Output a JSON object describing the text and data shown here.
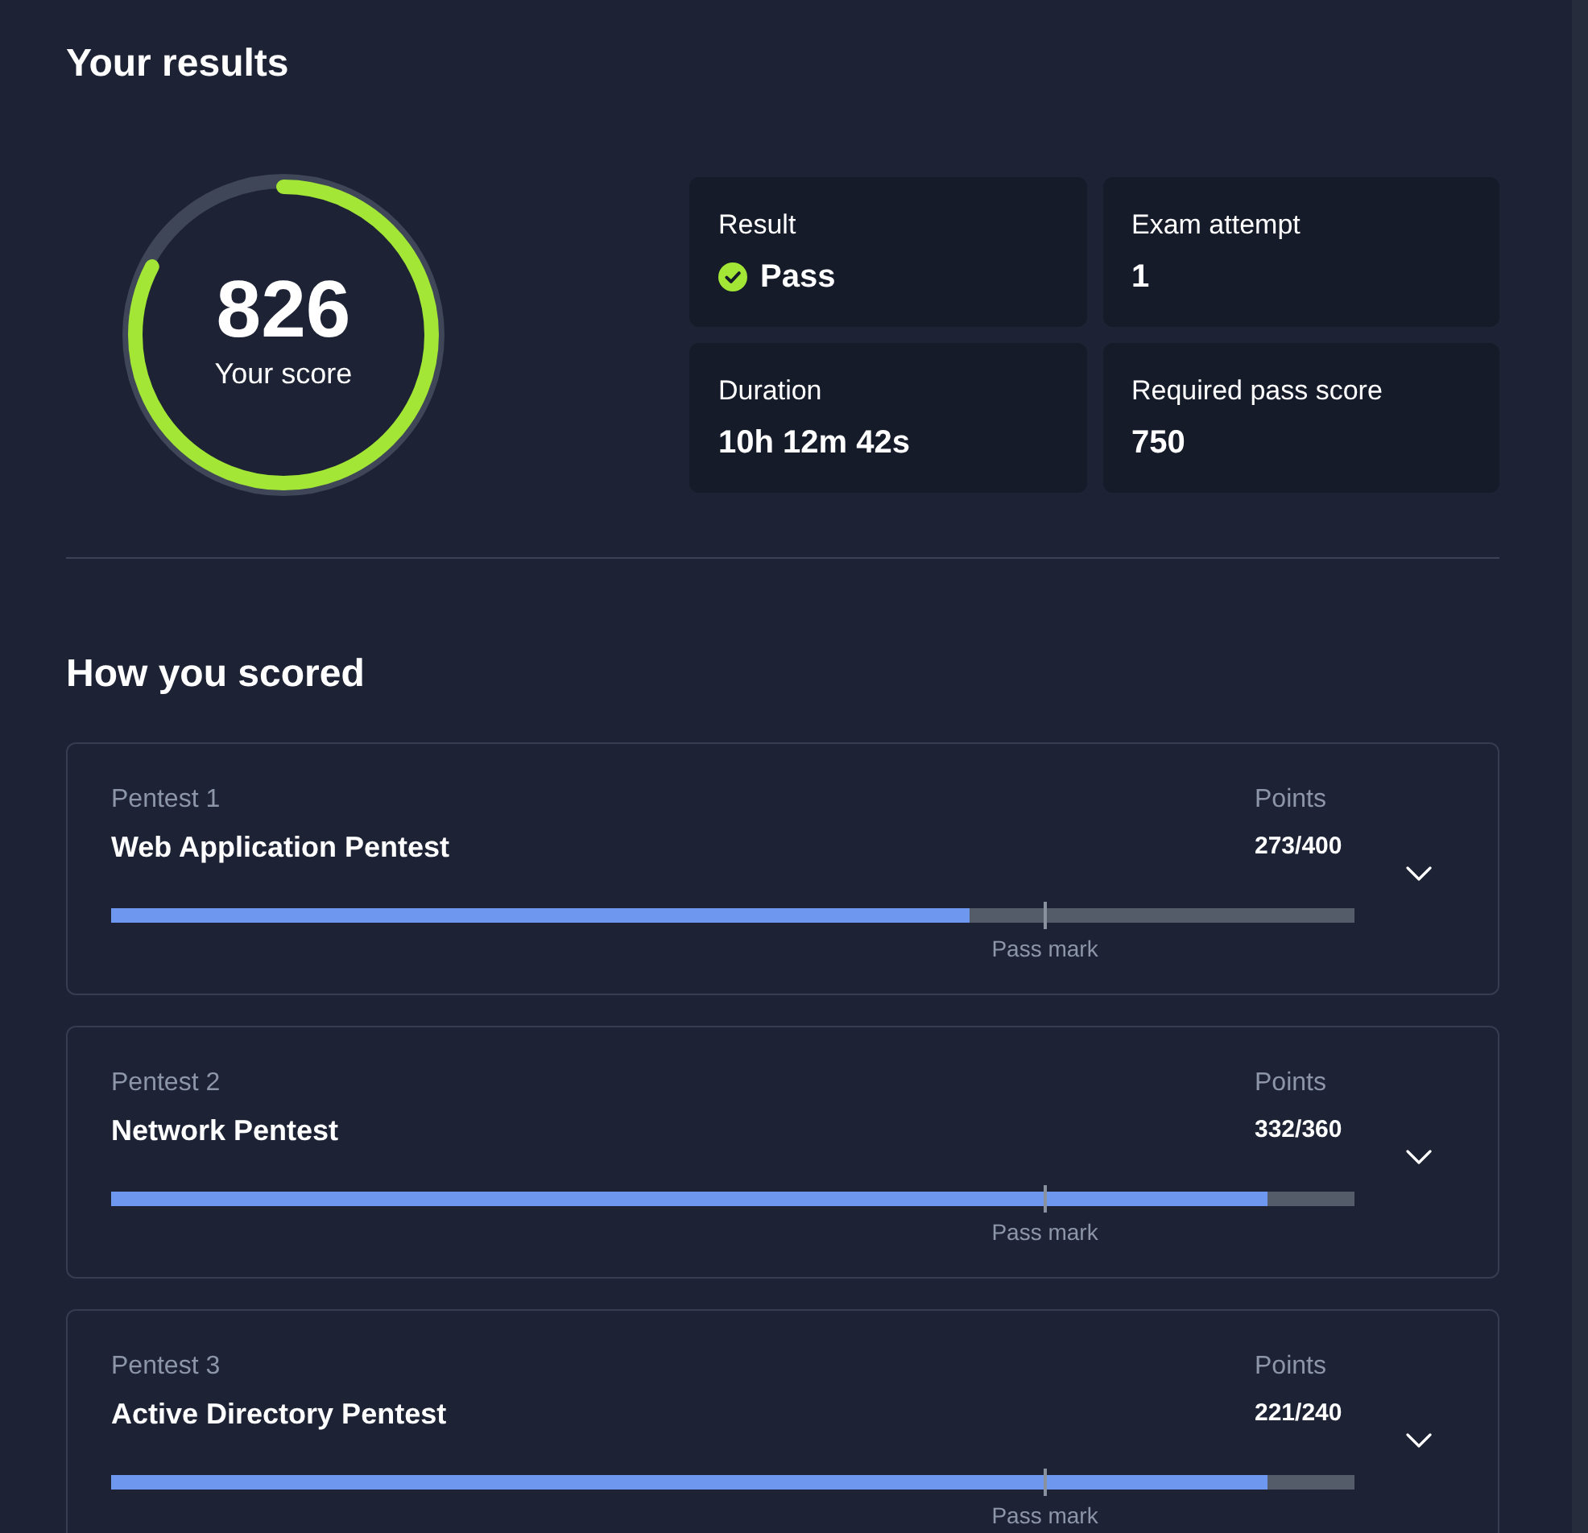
{
  "title": "Your results",
  "score": {
    "value": "826",
    "label": "Your score",
    "level": 0.826
  },
  "stats": [
    {
      "kind": "status",
      "label": "Result",
      "value": "Pass"
    },
    {
      "kind": "text",
      "label": "Exam attempt",
      "value": "1"
    },
    {
      "kind": "text",
      "label": "Duration",
      "value": "10h 12m 42s"
    },
    {
      "kind": "text",
      "label": "Required pass score",
      "value": "750"
    }
  ],
  "scoring": {
    "title": "How you scored",
    "sections": [
      {
        "label": "Pentest 1",
        "title": "Web Application Pentest",
        "points_label": "Points",
        "points": "273/400",
        "level": 0.69,
        "pass_mark": {
          "label": "Pass mark",
          "level": 0.751
        },
        "expanded": false
      },
      {
        "label": "Pentest 2",
        "title": "Network Pentest",
        "points_label": "Points",
        "points": "332/360",
        "level": 0.93,
        "pass_mark": {
          "label": "Pass mark",
          "level": 0.751
        },
        "expanded": false
      },
      {
        "label": "Pentest 3",
        "title": "Active Directory Pentest",
        "points_label": "Points",
        "points": "221/240",
        "level": 0.93,
        "pass_mark": {
          "label": "Pass mark",
          "level": 0.751
        },
        "expanded": false
      }
    ]
  }
}
